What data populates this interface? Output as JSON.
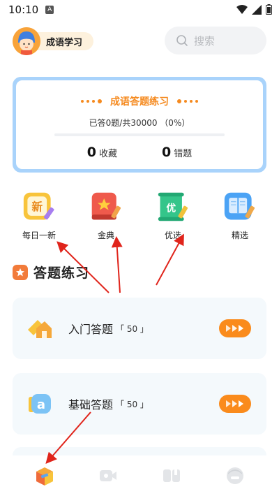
{
  "status_bar": {
    "time": "10:10",
    "notification_glyph": "A"
  },
  "header": {
    "user_name": "成语学习",
    "search_placeholder": "搜索"
  },
  "progress_card": {
    "title": "成语答题练习",
    "progress_text": "已答0题/共30000 （0%）",
    "progress_fraction": 0,
    "favorites": {
      "count": "0",
      "label": "收藏"
    },
    "wrong": {
      "count": "0",
      "label": "错题"
    }
  },
  "categories": [
    {
      "label": "每日一新",
      "icon": "new-badge-icon",
      "icon_text": "新",
      "color": "#f8c43b"
    },
    {
      "label": "金典",
      "icon": "red-book-icon",
      "color": "#ef5a4c"
    },
    {
      "label": "优选",
      "icon": "green-scroll-icon",
      "icon_text": "优",
      "color": "#34c58a"
    },
    {
      "label": "精选",
      "icon": "blue-book-icon",
      "color": "#4ba3f5"
    }
  ],
  "section": {
    "title": "答题练习"
  },
  "quizzes": [
    {
      "name": "入门答题",
      "count": "「 50 」",
      "icon": "house-icon"
    },
    {
      "name": "基础答题",
      "count": "「 50 」",
      "icon": "letter-a-ticket-icon"
    }
  ],
  "bottom_nav": [
    {
      "icon": "home-box-icon",
      "active": true
    },
    {
      "icon": "video-icon",
      "active": false
    },
    {
      "icon": "book-icon",
      "active": false
    },
    {
      "icon": "face-icon",
      "active": false
    }
  ],
  "colors": {
    "accent": "#f58a1f",
    "card_border": "#a9d3fb",
    "row_bg": "#f4f9fc",
    "annotation": "#e0241b"
  }
}
